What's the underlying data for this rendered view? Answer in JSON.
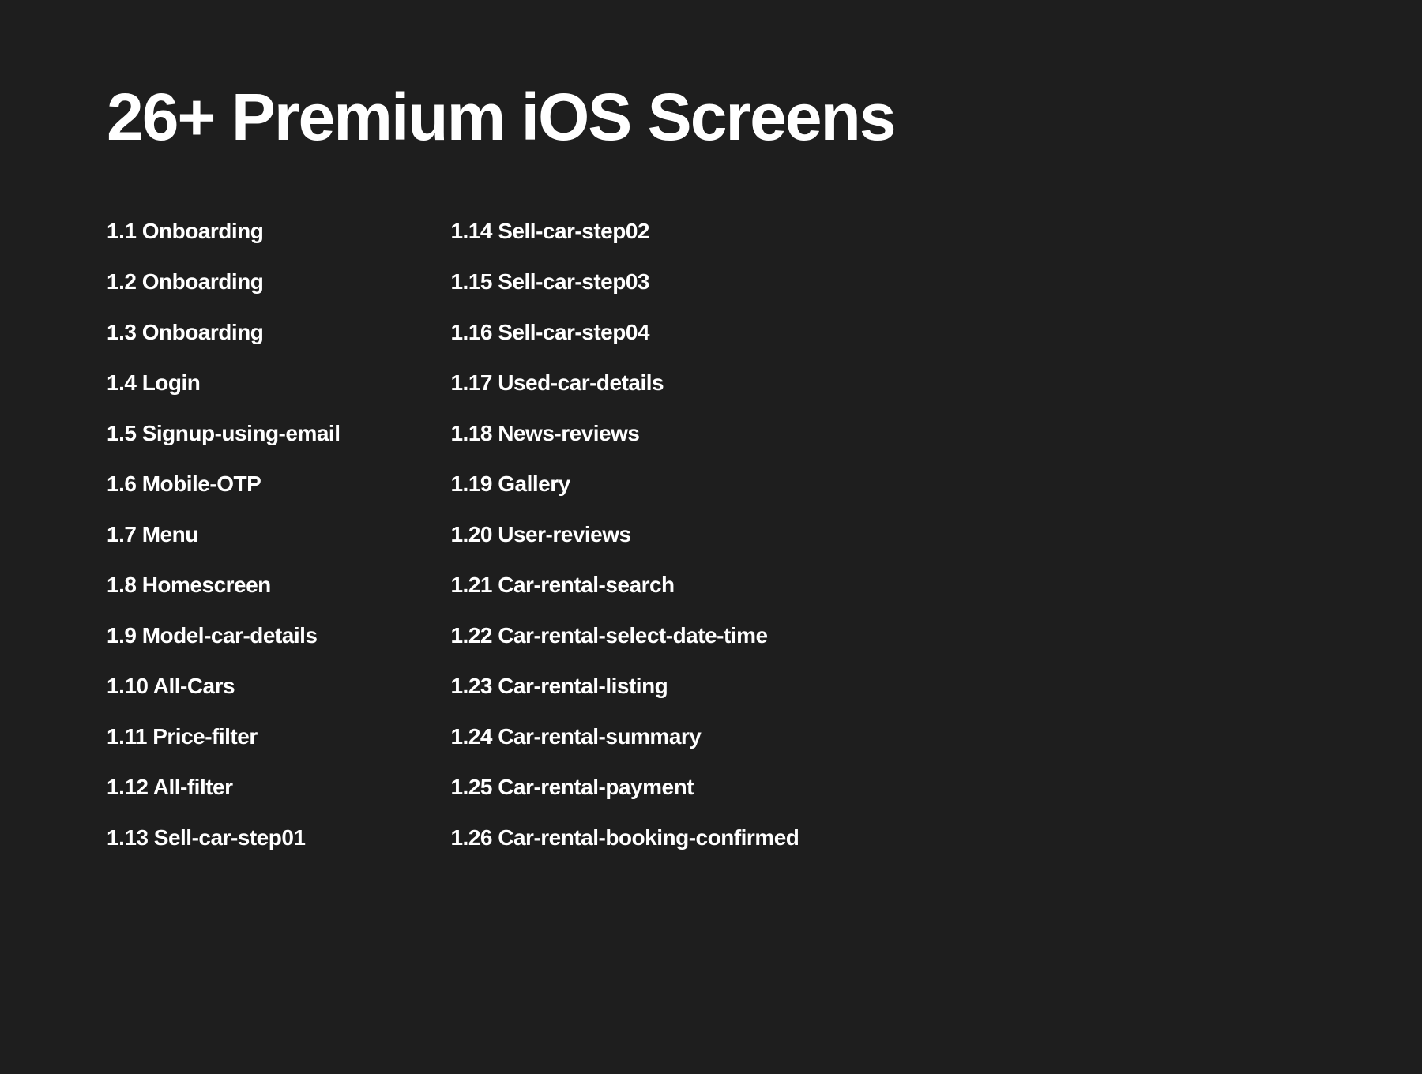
{
  "heading": "26+ Premium iOS Screens",
  "column1": [
    "1.1 Onboarding",
    "1.2 Onboarding",
    "1.3 Onboarding",
    "1.4 Login",
    "1.5 Signup-using-email",
    "1.6 Mobile-OTP",
    "1.7 Menu",
    "1.8 Homescreen",
    "1.9 Model-car-details",
    "1.10 All-Cars",
    "1.11 Price-filter",
    "1.12 All-filter",
    "1.13 Sell-car-step01"
  ],
  "column2": [
    "1.14 Sell-car-step02",
    "1.15 Sell-car-step03",
    "1.16 Sell-car-step04",
    "1.17 Used-car-details",
    "1.18 News-reviews",
    "1.19 Gallery",
    "1.20 User-reviews",
    "1.21 Car-rental-search",
    "1.22 Car-rental-select-date-time",
    "1.23 Car-rental-listing",
    "1.24 Car-rental-summary",
    "1.25 Car-rental-payment",
    "1.26 Car-rental-booking-confirmed"
  ]
}
